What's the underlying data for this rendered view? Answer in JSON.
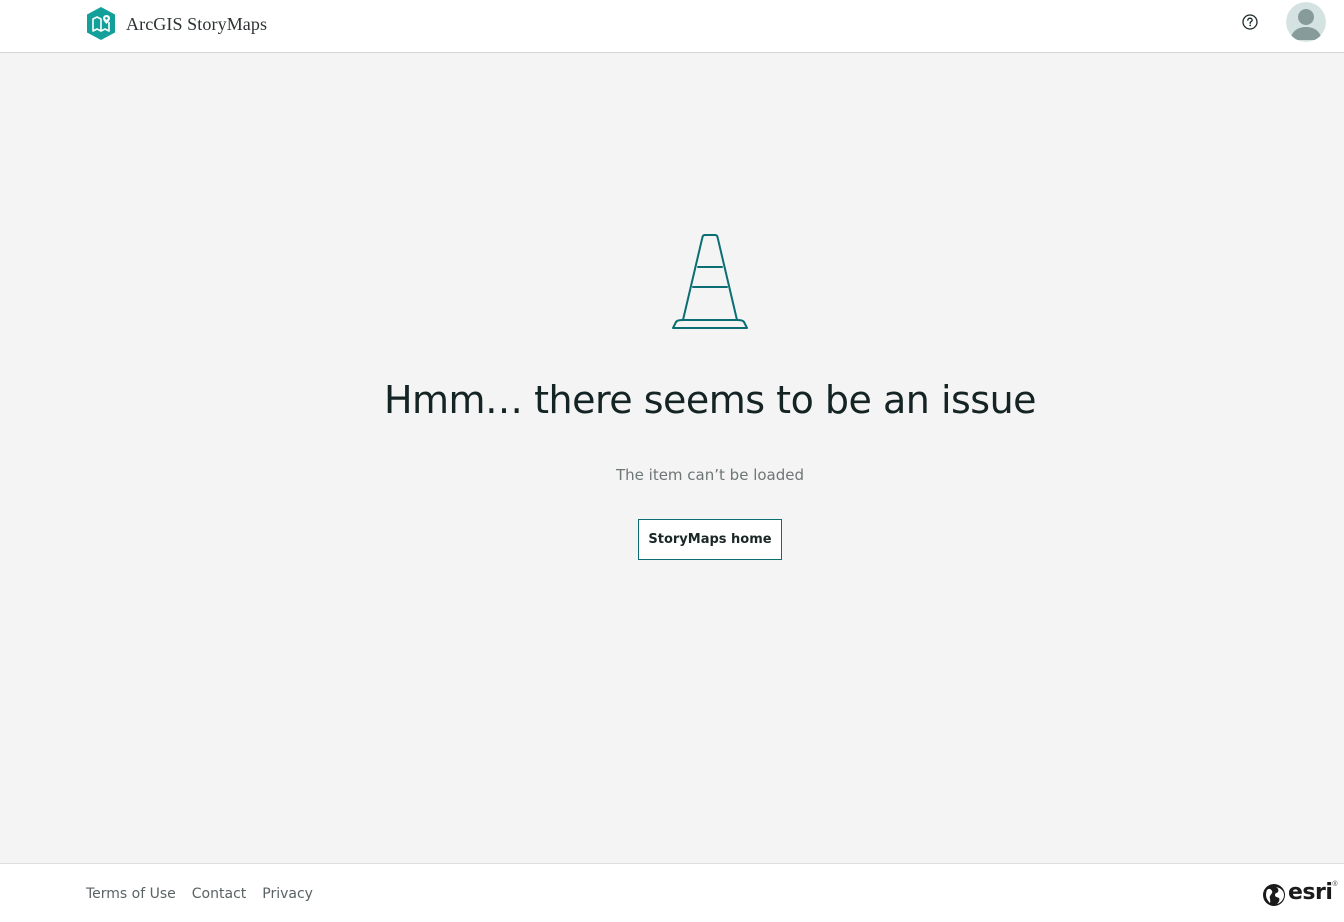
{
  "header": {
    "brand_name": "ArcGIS StoryMaps",
    "help_icon": "help-circle-icon",
    "avatar_icon": "user-avatar-icon"
  },
  "main": {
    "illustration": "traffic-cone-icon",
    "title": "Hmm… there seems to be an issue",
    "subtitle": "The item can’t be loaded",
    "home_button_label": "StoryMaps home"
  },
  "footer": {
    "links": [
      {
        "label": "Terms of Use"
      },
      {
        "label": "Contact"
      },
      {
        "label": "Privacy"
      }
    ],
    "esri_logo_text": "esri",
    "esri_trademark": "®"
  },
  "colors": {
    "accent": "#0b6e73",
    "brand_teal": "#14a09a",
    "background": "#f3f4f3",
    "header_bg": "#ffffff"
  }
}
